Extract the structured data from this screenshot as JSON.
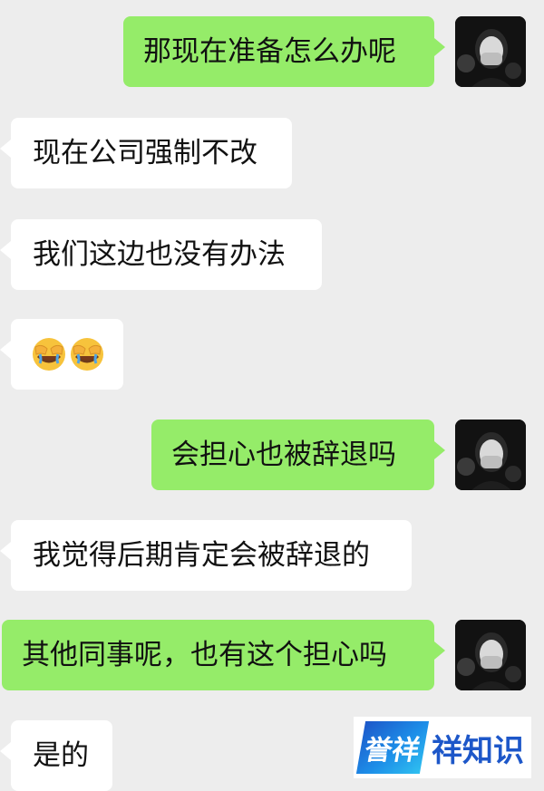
{
  "chat": {
    "messages": [
      {
        "side": "sent",
        "text": "那现在准备怎么办呢"
      },
      {
        "side": "received",
        "text": "现在公司强制不改"
      },
      {
        "side": "received",
        "text": "我们这边也没有办法"
      },
      {
        "side": "received",
        "emoji": [
          "face-palm-emoji",
          "face-palm-emoji"
        ]
      },
      {
        "side": "sent",
        "text": "会担心也被辞退吗"
      },
      {
        "side": "received",
        "text": "我觉得后期肯定会被辞退的"
      },
      {
        "side": "sent",
        "text": "其他同事呢，也有这个担心吗"
      },
      {
        "side": "received",
        "text": "是的"
      }
    ]
  },
  "colors": {
    "background": "#ededed",
    "sent_bubble": "#95ec69",
    "received_bubble": "#ffffff",
    "watermark_blue": "#1d57c9"
  },
  "watermark": {
    "logo_text": "誉祥",
    "brand_text": "祥知识"
  }
}
